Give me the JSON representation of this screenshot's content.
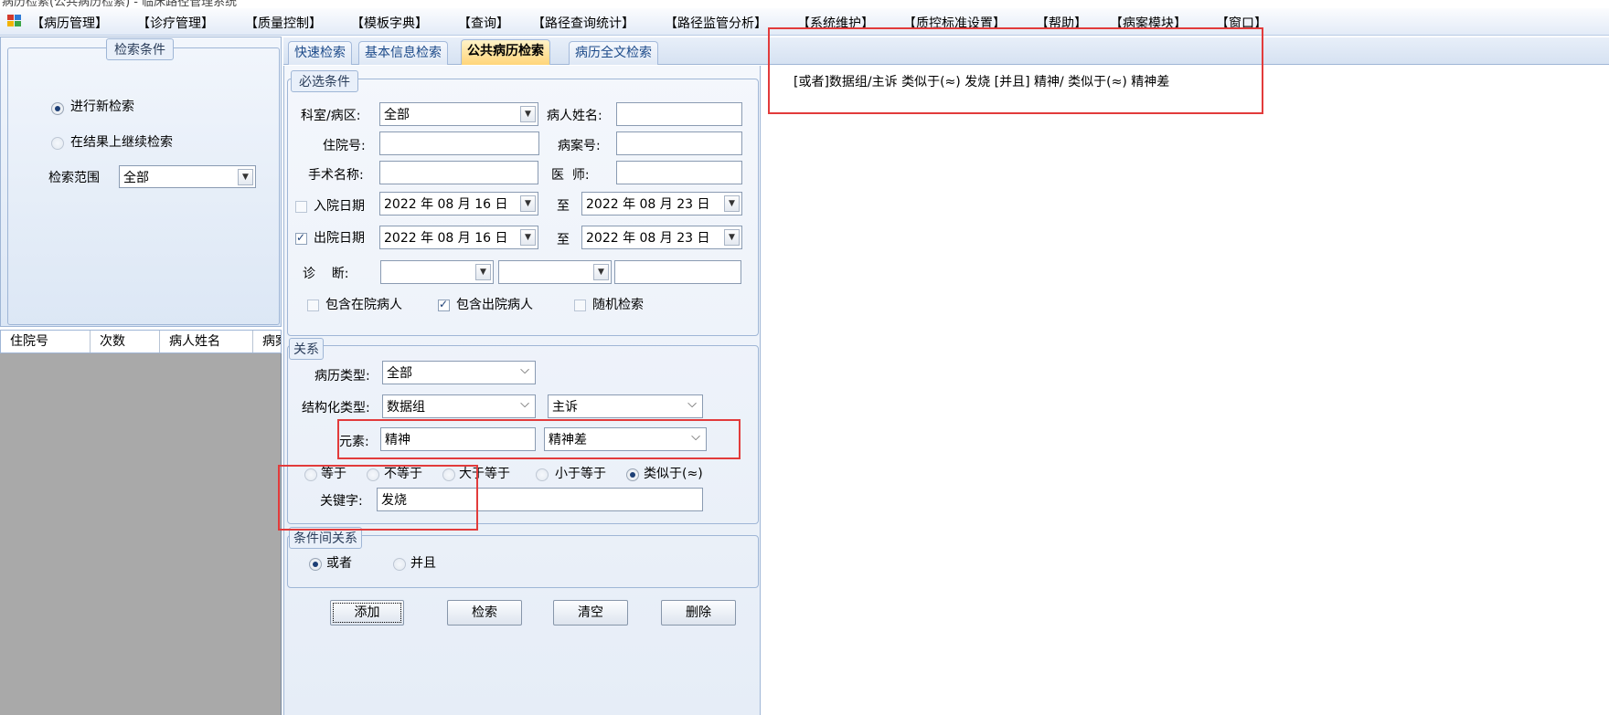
{
  "window": {
    "title": "病历检索(公共病历检索) - 临床路径管理系统"
  },
  "menu": {
    "items": [
      "【病历管理】",
      "【诊疗管理】",
      "【质量控制】",
      "【模板字典】",
      "【查询】",
      "【路径查询统计】",
      "【路径监管分析】",
      "【系统维护】",
      "【质控标准设置】",
      "【帮助】",
      "【病案模块】",
      "【窗口】"
    ]
  },
  "left": {
    "group_title": "检索条件",
    "radio_new": "进行新检索",
    "radio_continue": "在结果上继续检索",
    "scope_label": "检索范围",
    "scope_value": "全部",
    "columns": [
      "住院号",
      "次数",
      "病人姓名",
      "病案"
    ]
  },
  "tabs": [
    "快速检索",
    "基本信息检索",
    "公共病历检索",
    "病历全文检索"
  ],
  "required": {
    "title": "必选条件",
    "dept_label": "科室/病区:",
    "dept_value": "全部",
    "patient_name_label": "病人姓名:",
    "patient_name_value": "",
    "inpatient_no_label": "住院号:",
    "inpatient_no_value": "",
    "record_no_label": "病案号:",
    "record_no_value": "",
    "surgery_label": "手术名称:",
    "surgery_value": "",
    "doctor_label": "医  师:",
    "doctor_value": "",
    "admit_date_label": "入院日期",
    "admit_date_from": "2022 年 08 月 16 日",
    "admit_to": "至",
    "admit_date_to": "2022 年 08 月 23 日",
    "admit_checked": false,
    "discharge_date_label": "出院日期",
    "discharge_date_from": "2022 年 08 月 16 日",
    "discharge_to": "至",
    "discharge_date_to": "2022 年 08 月 23 日",
    "discharge_checked": true,
    "diagnosis_label": "诊    断:",
    "diag_value1": "",
    "diag_value2": "",
    "diag_value3": "",
    "include_inpatient": "包含在院病人",
    "include_inpatient_checked": false,
    "include_discharged": "包含出院病人",
    "include_discharged_checked": true,
    "random_search": "随机检索",
    "random_checked": false
  },
  "relation": {
    "title": "关系",
    "record_type_label": "病历类型:",
    "record_type_value": "全部",
    "struct_type_label": "结构化类型:",
    "struct_type_value1": "数据组",
    "struct_type_value2": "主诉",
    "element_label": "元素:",
    "element_value1": "精神",
    "element_value2": "精神差",
    "op_equal": "等于",
    "op_not_equal": "不等于",
    "op_gte": "大于等于",
    "op_lte": "小于等于",
    "op_like": "类似于(≈)",
    "op_selected": "op_like",
    "keyword_label": "关键字:",
    "keyword_value": "发烧"
  },
  "conditions": {
    "title": "条件间关系",
    "or_label": "或者",
    "and_label": "并且",
    "selected": "or"
  },
  "buttons": {
    "add": "添加",
    "search": "检索",
    "clear": "清空",
    "delete": "删除"
  },
  "result": {
    "expression": "[或者]数据组/主诉 类似于(≈) 发烧 [并且] 精神/ 类似于(≈) 精神差"
  },
  "colors": {
    "highlight": "#e23b3b",
    "active_tab": "#ffd57a"
  }
}
